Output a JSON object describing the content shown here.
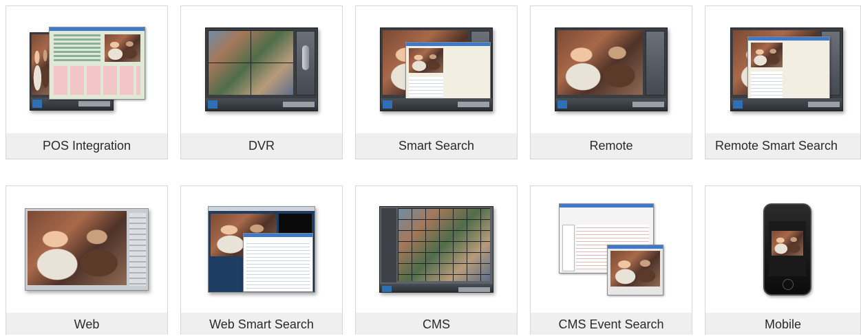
{
  "tiles": [
    {
      "label": "POS Integration"
    },
    {
      "label": "DVR"
    },
    {
      "label": "Smart Search"
    },
    {
      "label": "Remote"
    },
    {
      "label": "Remote Smart Search"
    },
    {
      "label": "Web"
    },
    {
      "label": "Web Smart Search"
    },
    {
      "label": "CMS"
    },
    {
      "label": "CMS Event Search"
    },
    {
      "label": "Mobile"
    }
  ]
}
